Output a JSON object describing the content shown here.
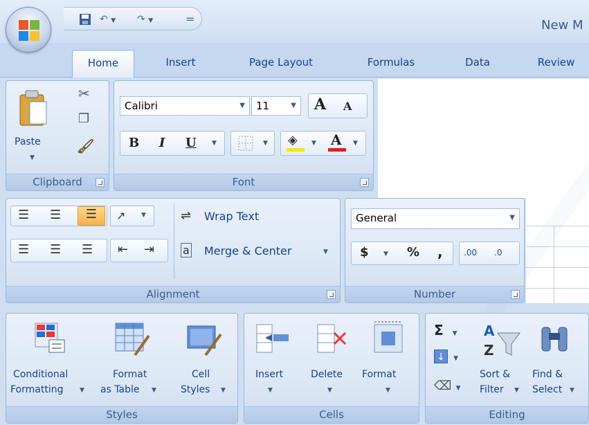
{
  "window": {
    "title": "New M"
  },
  "quick_access": {
    "save_icon": "save-icon",
    "undo_icon": "undo-icon",
    "redo_icon": "redo-icon",
    "customize_glyph": "="
  },
  "tabs": [
    {
      "label": "Home",
      "active": true
    },
    {
      "label": "Insert"
    },
    {
      "label": "Page Layout"
    },
    {
      "label": "Formulas"
    },
    {
      "label": "Data"
    },
    {
      "label": "Review"
    }
  ],
  "clipboard": {
    "paste_label": "Paste",
    "group_label": "Clipboard",
    "cut_icon": "scissors-icon",
    "copy_icon": "copy-icon",
    "format_painter_icon": "format-painter-icon"
  },
  "font": {
    "font_name": "Calibri",
    "font_size": "11",
    "group_label": "Font",
    "bold": "B",
    "italic": "I",
    "underline": "U",
    "grow": "A",
    "shrink": "A",
    "font_color_letter": "A",
    "fill_color": "#f5e60a",
    "font_color": "#e02020"
  },
  "alignment": {
    "wrap_text": "Wrap Text",
    "merge_center": "Merge & Center",
    "group_label": "Alignment"
  },
  "number": {
    "format": "General",
    "currency": "$",
    "percent": "%",
    "comma": ",",
    "inc_decimal": ".00",
    "dec_decimal": ".0",
    "group_label": "Number"
  },
  "styles": {
    "conditional_line1": "Conditional",
    "conditional_line2": "Formatting",
    "format_table_line1": "Format",
    "format_table_line2": "as Table",
    "cell_styles_line1": "Cell",
    "cell_styles_line2": "Styles",
    "group_label": "Styles"
  },
  "cells": {
    "insert": "Insert",
    "delete": "Delete",
    "format": "Format",
    "group_label": "Cells"
  },
  "editing": {
    "sigma": "Σ",
    "sort_line1": "Sort &",
    "sort_line2": "Filter",
    "find_line1": "Find &",
    "find_line2": "Select",
    "group_label": "Editing"
  }
}
